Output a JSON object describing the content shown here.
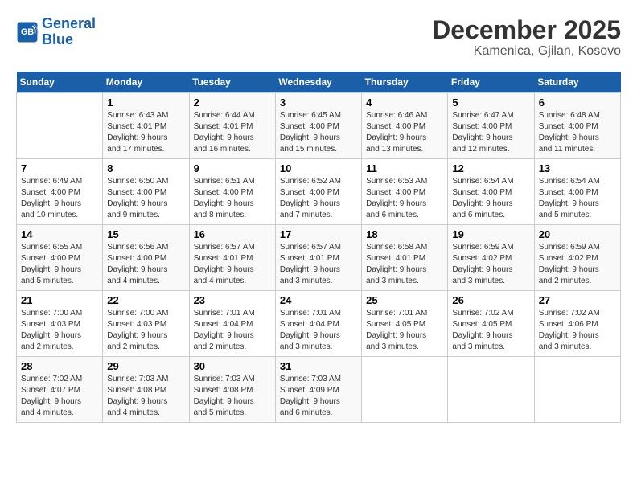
{
  "logo": {
    "line1": "General",
    "line2": "Blue"
  },
  "title": "December 2025",
  "subtitle": "Kamenica, Gjilan, Kosovo",
  "days_of_week": [
    "Sunday",
    "Monday",
    "Tuesday",
    "Wednesday",
    "Thursday",
    "Friday",
    "Saturday"
  ],
  "weeks": [
    [
      {
        "day": "",
        "info": ""
      },
      {
        "day": "1",
        "info": "Sunrise: 6:43 AM\nSunset: 4:01 PM\nDaylight: 9 hours\nand 17 minutes."
      },
      {
        "day": "2",
        "info": "Sunrise: 6:44 AM\nSunset: 4:01 PM\nDaylight: 9 hours\nand 16 minutes."
      },
      {
        "day": "3",
        "info": "Sunrise: 6:45 AM\nSunset: 4:00 PM\nDaylight: 9 hours\nand 15 minutes."
      },
      {
        "day": "4",
        "info": "Sunrise: 6:46 AM\nSunset: 4:00 PM\nDaylight: 9 hours\nand 13 minutes."
      },
      {
        "day": "5",
        "info": "Sunrise: 6:47 AM\nSunset: 4:00 PM\nDaylight: 9 hours\nand 12 minutes."
      },
      {
        "day": "6",
        "info": "Sunrise: 6:48 AM\nSunset: 4:00 PM\nDaylight: 9 hours\nand 11 minutes."
      }
    ],
    [
      {
        "day": "7",
        "info": "Sunrise: 6:49 AM\nSunset: 4:00 PM\nDaylight: 9 hours\nand 10 minutes."
      },
      {
        "day": "8",
        "info": "Sunrise: 6:50 AM\nSunset: 4:00 PM\nDaylight: 9 hours\nand 9 minutes."
      },
      {
        "day": "9",
        "info": "Sunrise: 6:51 AM\nSunset: 4:00 PM\nDaylight: 9 hours\nand 8 minutes."
      },
      {
        "day": "10",
        "info": "Sunrise: 6:52 AM\nSunset: 4:00 PM\nDaylight: 9 hours\nand 7 minutes."
      },
      {
        "day": "11",
        "info": "Sunrise: 6:53 AM\nSunset: 4:00 PM\nDaylight: 9 hours\nand 6 minutes."
      },
      {
        "day": "12",
        "info": "Sunrise: 6:54 AM\nSunset: 4:00 PM\nDaylight: 9 hours\nand 6 minutes."
      },
      {
        "day": "13",
        "info": "Sunrise: 6:54 AM\nSunset: 4:00 PM\nDaylight: 9 hours\nand 5 minutes."
      }
    ],
    [
      {
        "day": "14",
        "info": "Sunrise: 6:55 AM\nSunset: 4:00 PM\nDaylight: 9 hours\nand 5 minutes."
      },
      {
        "day": "15",
        "info": "Sunrise: 6:56 AM\nSunset: 4:00 PM\nDaylight: 9 hours\nand 4 minutes."
      },
      {
        "day": "16",
        "info": "Sunrise: 6:57 AM\nSunset: 4:01 PM\nDaylight: 9 hours\nand 4 minutes."
      },
      {
        "day": "17",
        "info": "Sunrise: 6:57 AM\nSunset: 4:01 PM\nDaylight: 9 hours\nand 3 minutes."
      },
      {
        "day": "18",
        "info": "Sunrise: 6:58 AM\nSunset: 4:01 PM\nDaylight: 9 hours\nand 3 minutes."
      },
      {
        "day": "19",
        "info": "Sunrise: 6:59 AM\nSunset: 4:02 PM\nDaylight: 9 hours\nand 3 minutes."
      },
      {
        "day": "20",
        "info": "Sunrise: 6:59 AM\nSunset: 4:02 PM\nDaylight: 9 hours\nand 2 minutes."
      }
    ],
    [
      {
        "day": "21",
        "info": "Sunrise: 7:00 AM\nSunset: 4:03 PM\nDaylight: 9 hours\nand 2 minutes."
      },
      {
        "day": "22",
        "info": "Sunrise: 7:00 AM\nSunset: 4:03 PM\nDaylight: 9 hours\nand 2 minutes."
      },
      {
        "day": "23",
        "info": "Sunrise: 7:01 AM\nSunset: 4:04 PM\nDaylight: 9 hours\nand 2 minutes."
      },
      {
        "day": "24",
        "info": "Sunrise: 7:01 AM\nSunset: 4:04 PM\nDaylight: 9 hours\nand 3 minutes."
      },
      {
        "day": "25",
        "info": "Sunrise: 7:01 AM\nSunset: 4:05 PM\nDaylight: 9 hours\nand 3 minutes."
      },
      {
        "day": "26",
        "info": "Sunrise: 7:02 AM\nSunset: 4:05 PM\nDaylight: 9 hours\nand 3 minutes."
      },
      {
        "day": "27",
        "info": "Sunrise: 7:02 AM\nSunset: 4:06 PM\nDaylight: 9 hours\nand 3 minutes."
      }
    ],
    [
      {
        "day": "28",
        "info": "Sunrise: 7:02 AM\nSunset: 4:07 PM\nDaylight: 9 hours\nand 4 minutes."
      },
      {
        "day": "29",
        "info": "Sunrise: 7:03 AM\nSunset: 4:08 PM\nDaylight: 9 hours\nand 4 minutes."
      },
      {
        "day": "30",
        "info": "Sunrise: 7:03 AM\nSunset: 4:08 PM\nDaylight: 9 hours\nand 5 minutes."
      },
      {
        "day": "31",
        "info": "Sunrise: 7:03 AM\nSunset: 4:09 PM\nDaylight: 9 hours\nand 6 minutes."
      },
      {
        "day": "",
        "info": ""
      },
      {
        "day": "",
        "info": ""
      },
      {
        "day": "",
        "info": ""
      }
    ]
  ]
}
